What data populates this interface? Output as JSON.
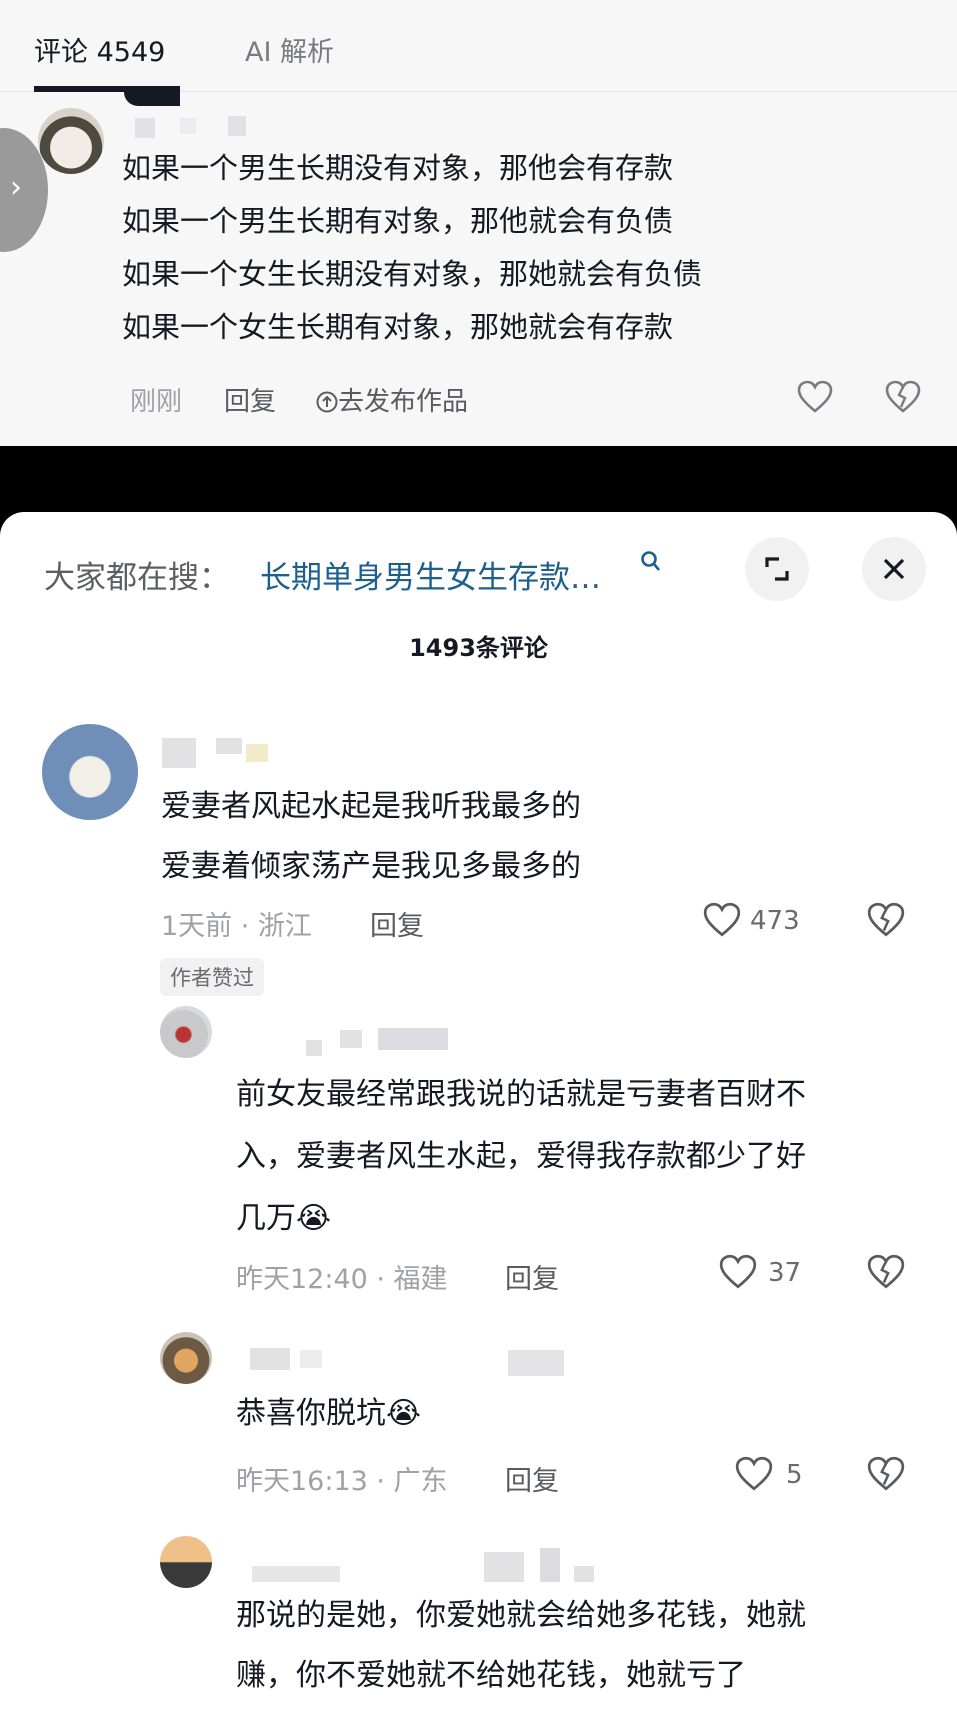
{
  "tabs": {
    "comments": "评论 4549",
    "ai": "AI 解析"
  },
  "top_comment": {
    "lines": [
      "如果一个男生长期没有对象，那他会有存款",
      "如果一个男生长期有对象，那他就会有负债",
      "如果一个女生长期没有对象，那她就会有负债",
      "如果一个女生长期有对象，那她就会有存款"
    ],
    "time": "刚刚",
    "reply": "回复",
    "publish": "去发布作品"
  },
  "sheet": {
    "search_prefix": "大家都在搜：",
    "search_query": "长期单身男生女生存款…",
    "comment_count": "1493条评论",
    "comments": [
      {
        "lines": [
          "爱妻者风起水起是我听我最多的",
          "爱妻着倾家荡产是我见多最多的"
        ],
        "time": "1天前 · 浙江",
        "reply": "回复",
        "likes": "473",
        "badge": "作者赞过"
      },
      {
        "lines": [
          "前女友最经常跟我说的话就是亏妻者百财不",
          "入，爱妻者风生水起，爱得我存款都少了好",
          "几万😭"
        ],
        "time": "昨天12:40 · 福建",
        "reply": "回复",
        "likes": "37"
      },
      {
        "lines": [
          "恭喜你脱坑😭"
        ],
        "time": "昨天16:13 · 广东",
        "reply": "回复",
        "likes": "5"
      },
      {
        "lines": [
          "那说的是她，你爱她就会给她多花钱，她就",
          "赚，你不爱她就不给她花钱，她就亏了"
        ]
      }
    ]
  },
  "colors": {
    "accent_link": "#1d5f8f",
    "text": "#161823",
    "muted": "#8a8b91"
  },
  "icons": [
    "chevron-right-icon",
    "heart-icon",
    "broken-heart-icon",
    "search-icon",
    "expand-icon",
    "close-icon",
    "publish-up-icon"
  ]
}
